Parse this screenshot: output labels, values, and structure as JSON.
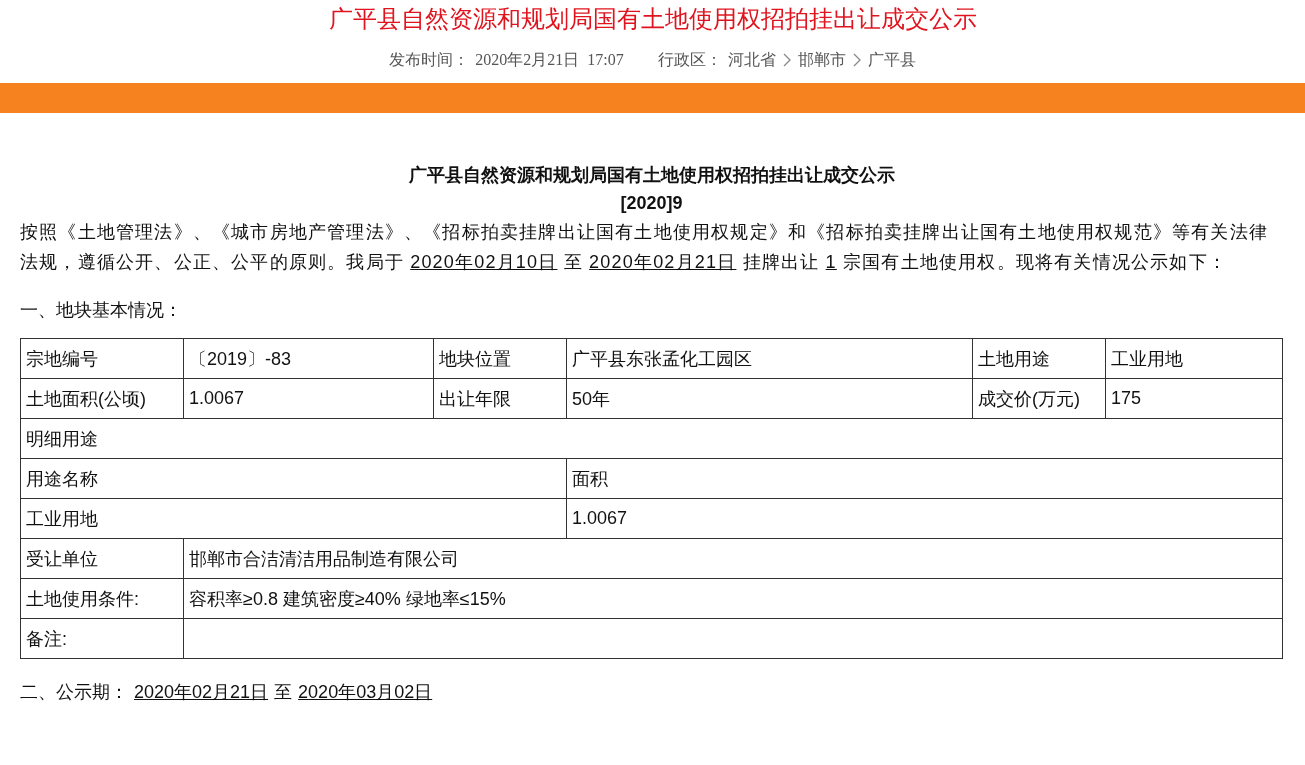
{
  "header": {
    "title": "广平县自然资源和规划局国有土地使用权招拍挂出让成交公示",
    "publish_label": "发布时间：",
    "publish_time": "2020年2月21日  17:07",
    "region_label": "行政区：",
    "breadcrumb": [
      "河北省",
      "邯郸市",
      "广平县"
    ]
  },
  "notice": {
    "title": "广平县自然资源和规划局国有土地使用权招拍挂出让成交公示",
    "number": "[2020]9",
    "intro": [
      {
        "text": "按照《土地管理法》、《城市房地产管理法》、《招标拍卖挂牌出让国有土地使用权规定》和《招标拍卖挂牌出让国有土地使用权规范》等有关法律法规，遵循公开、公正、公平的原则。我局于 ",
        "underline": false
      },
      {
        "text": "2020年02月10日",
        "underline": true
      },
      {
        "text": " 至 ",
        "underline": false
      },
      {
        "text": "2020年02月21日",
        "underline": true
      },
      {
        "text": " 挂牌出让 ",
        "underline": false
      },
      {
        "text": "1",
        "underline": true
      },
      {
        "text": " 宗国有土地使用权。现将有关情况公示如下：",
        "underline": false
      }
    ],
    "section_1": "一、地块基本情况：",
    "table": [
      {
        "kind": "six",
        "cells": [
          "宗地编号",
          "〔2019〕-83",
          "地块位置",
          "广平县东张孟化工园区",
          "土地用途",
          "工业用地"
        ]
      },
      {
        "kind": "six",
        "cells": [
          "土地面积(公顷)",
          "1.0067",
          "出让年限",
          "50年",
          "成交价(万元)",
          "175"
        ]
      },
      {
        "kind": "full",
        "cells": [
          "明细用途"
        ]
      },
      {
        "kind": "half",
        "cells": [
          "用途名称",
          "面积"
        ]
      },
      {
        "kind": "half",
        "cells": [
          "工业用地",
          "1.0067"
        ]
      },
      {
        "kind": "pair",
        "cells": [
          "受让单位",
          "邯郸市合洁清洁用品制造有限公司"
        ]
      },
      {
        "kind": "pair",
        "cells": [
          "土地使用条件:",
          "容积率≥0.8 建筑密度≥40% 绿地率≤15%"
        ]
      },
      {
        "kind": "pair",
        "cells": [
          "备注:"
        ]
      }
    ],
    "section_2": {
      "label": "二、公示期：",
      "from": "2020年02月21日",
      "to_word": "至",
      "to": "2020年03月02日"
    }
  }
}
